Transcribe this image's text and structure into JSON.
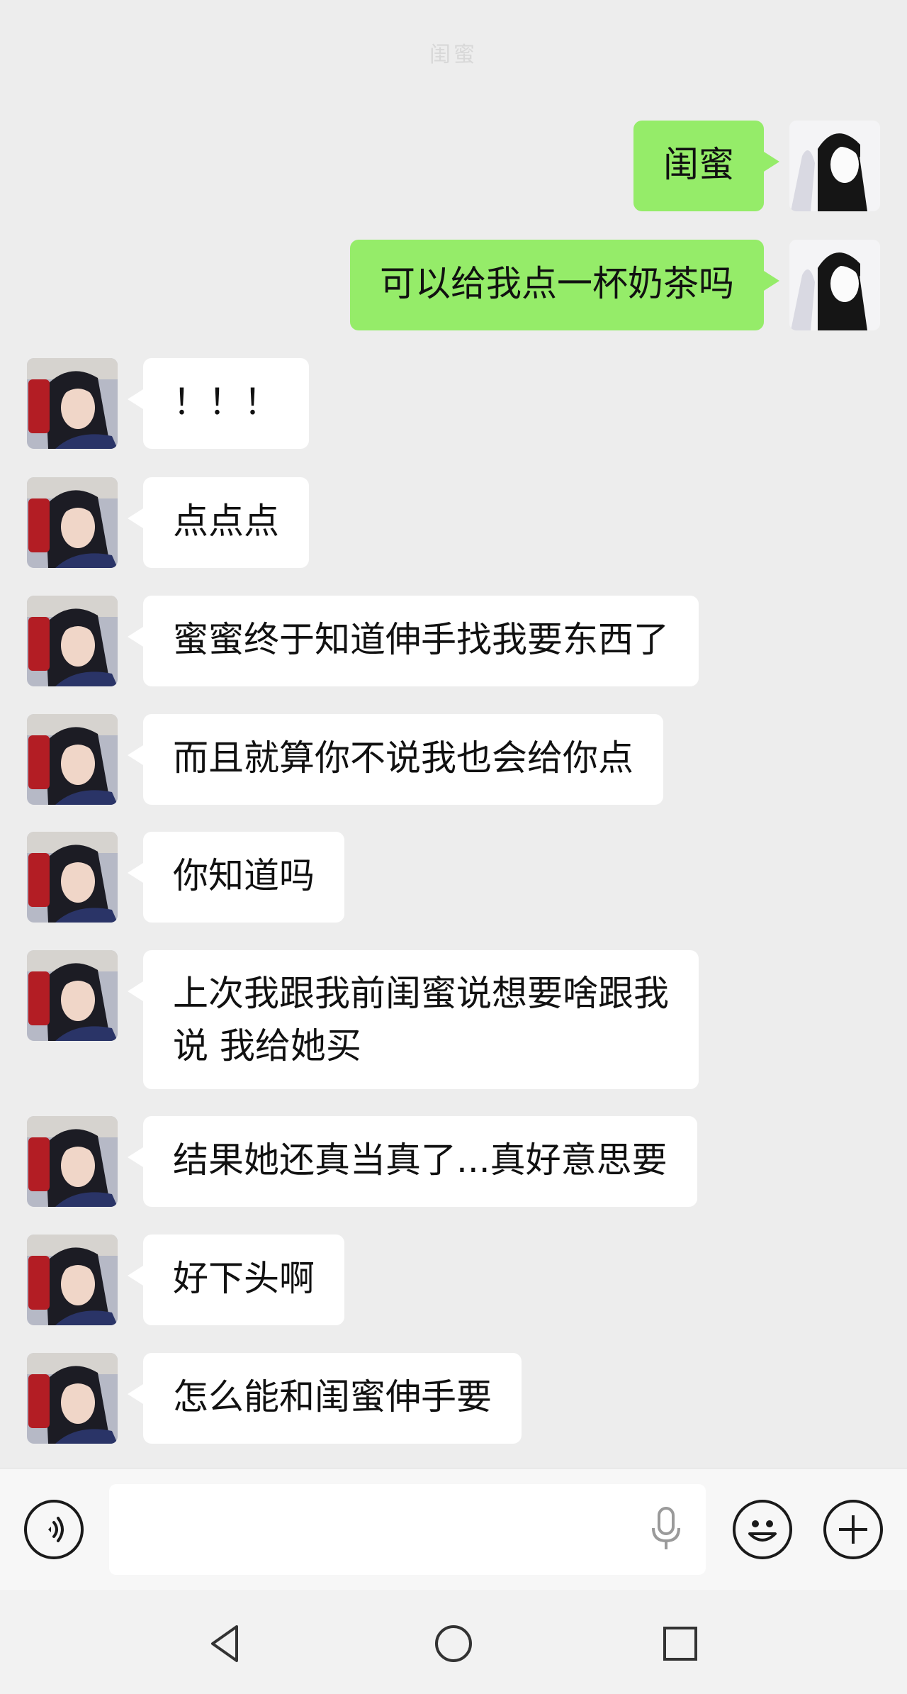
{
  "header": {
    "title": "闺蜜"
  },
  "messages": [
    {
      "from": "me",
      "text": "闺蜜"
    },
    {
      "from": "me",
      "text": "可以给我点一杯奶茶吗"
    },
    {
      "from": "friend",
      "text": "！！！"
    },
    {
      "from": "friend",
      "text": "点点点"
    },
    {
      "from": "friend",
      "text": "蜜蜜终于知道伸手找我要东西了"
    },
    {
      "from": "friend",
      "text": "而且就算你不说我也会给你点"
    },
    {
      "from": "friend",
      "text": "你知道吗"
    },
    {
      "from": "friend",
      "text": "上次我跟我前闺蜜说想要啥跟我\n说 我给她买"
    },
    {
      "from": "friend",
      "text": "结果她还真当真了...真好意思要"
    },
    {
      "from": "friend",
      "text": "好下头啊"
    },
    {
      "from": "friend",
      "text": "怎么能和闺蜜伸手要"
    }
  ],
  "input_bar": {
    "voice_icon": "voice-toggle-icon",
    "input_value": "",
    "mic_icon": "microphone-icon",
    "emoji_icon": "emoji-icon",
    "plus_icon": "plus-icon"
  },
  "nav_bar": {
    "back_icon": "triangle-back-icon",
    "home_icon": "circle-home-icon",
    "recents_icon": "square-recents-icon"
  },
  "colors": {
    "background": "#ededed",
    "my_bubble": "#95ec69",
    "friend_bubble": "#ffffff",
    "text": "#111111"
  }
}
